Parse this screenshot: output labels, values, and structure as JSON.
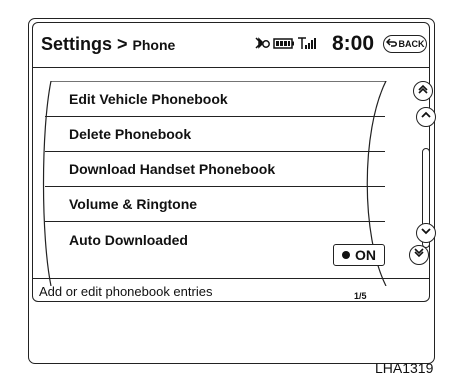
{
  "header": {
    "title": "Settings >",
    "subtitle": "Phone",
    "time": "8:00",
    "back_label": "BACK",
    "icons": [
      "bluetooth-icon",
      "battery-icon",
      "signal-icon"
    ]
  },
  "menu": {
    "items": [
      {
        "label": "Edit Vehicle Phonebook"
      },
      {
        "label": "Delete Phonebook"
      },
      {
        "label": "Download Handset Phonebook"
      },
      {
        "label": "Volume & Ringtone"
      },
      {
        "label": "Auto Downloaded"
      }
    ],
    "toggle_value": "ON",
    "page_indicator": "1/5"
  },
  "help_text": "Add or edit phonebook entries",
  "figure_code": "LHA1319"
}
